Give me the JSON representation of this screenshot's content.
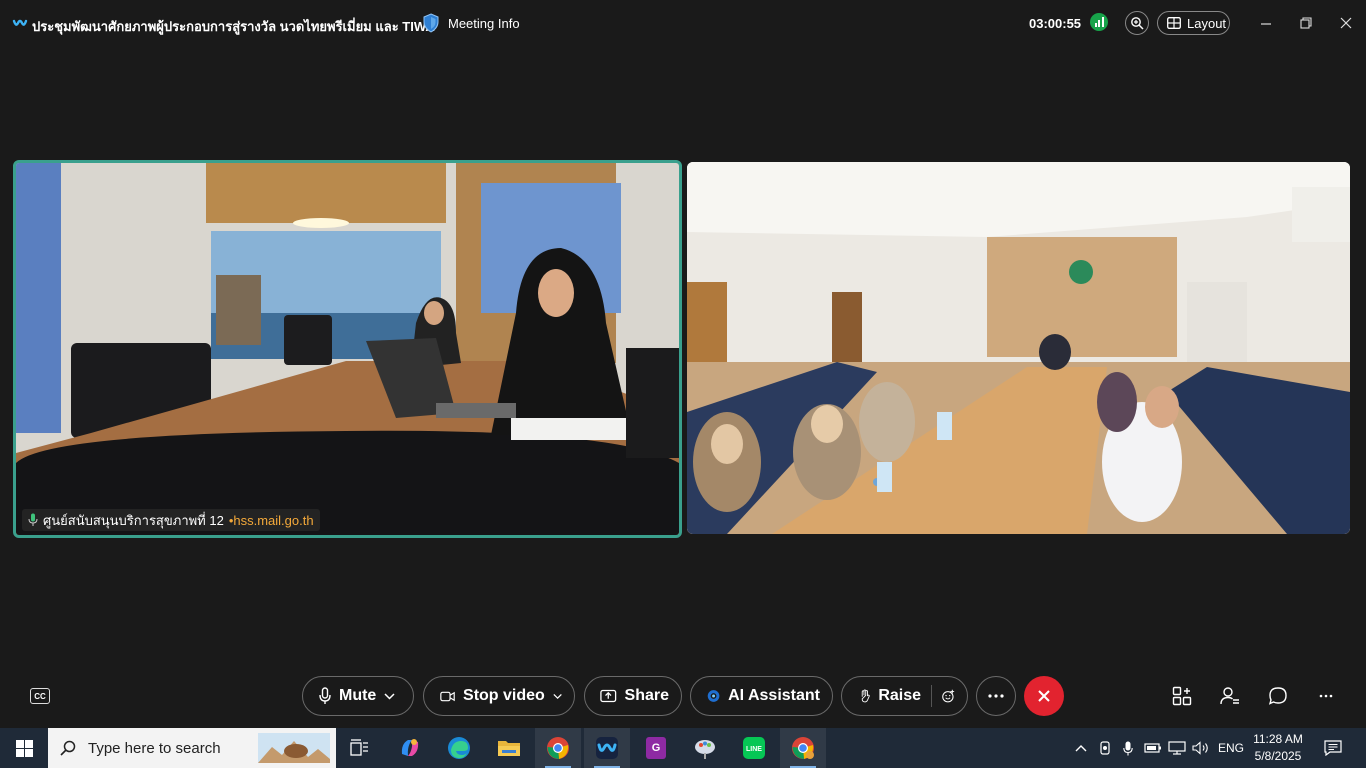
{
  "meeting": {
    "title": "ประชุมพัฒนาศักยภาพผู้ประกอบการสู่รางวัล นวดไทยพรีเมี่ยม และ TIWA",
    "info_label": "Meeting Info",
    "timer": "03:00:55",
    "layout_label": "Layout"
  },
  "tiles": {
    "left": {
      "name": "ศูนย์สนับสนุนบริการสุขภาพที่ 12",
      "domain": "•hss.mail.go.th"
    }
  },
  "controls": {
    "mute": "Mute",
    "stop_video": "Stop video",
    "share": "Share",
    "ai_assistant": "AI Assistant",
    "raise": "Raise"
  },
  "taskbar": {
    "search_placeholder": "Type here to search",
    "language": "ENG",
    "time": "11:28 AM",
    "date": "5/8/2025"
  },
  "colors": {
    "active_speaker_border": "#3aa08d",
    "end_call": "#e2232f",
    "signal": "#17a34a",
    "domain_text": "#f4a93a"
  },
  "icons": [
    "webex-logo-icon",
    "shield-icon",
    "signal-icon",
    "zoom-icon",
    "layout-icon",
    "minimize-icon",
    "maximize-icon",
    "close-icon",
    "mic-icon",
    "camera-icon",
    "share-icon",
    "ai-icon",
    "hand-icon",
    "emoji-icon",
    "more-icon",
    "end-call-icon",
    "captions-icon",
    "apps-icon",
    "participants-icon",
    "chat-icon",
    "windows-start-icon",
    "search-icon"
  ]
}
